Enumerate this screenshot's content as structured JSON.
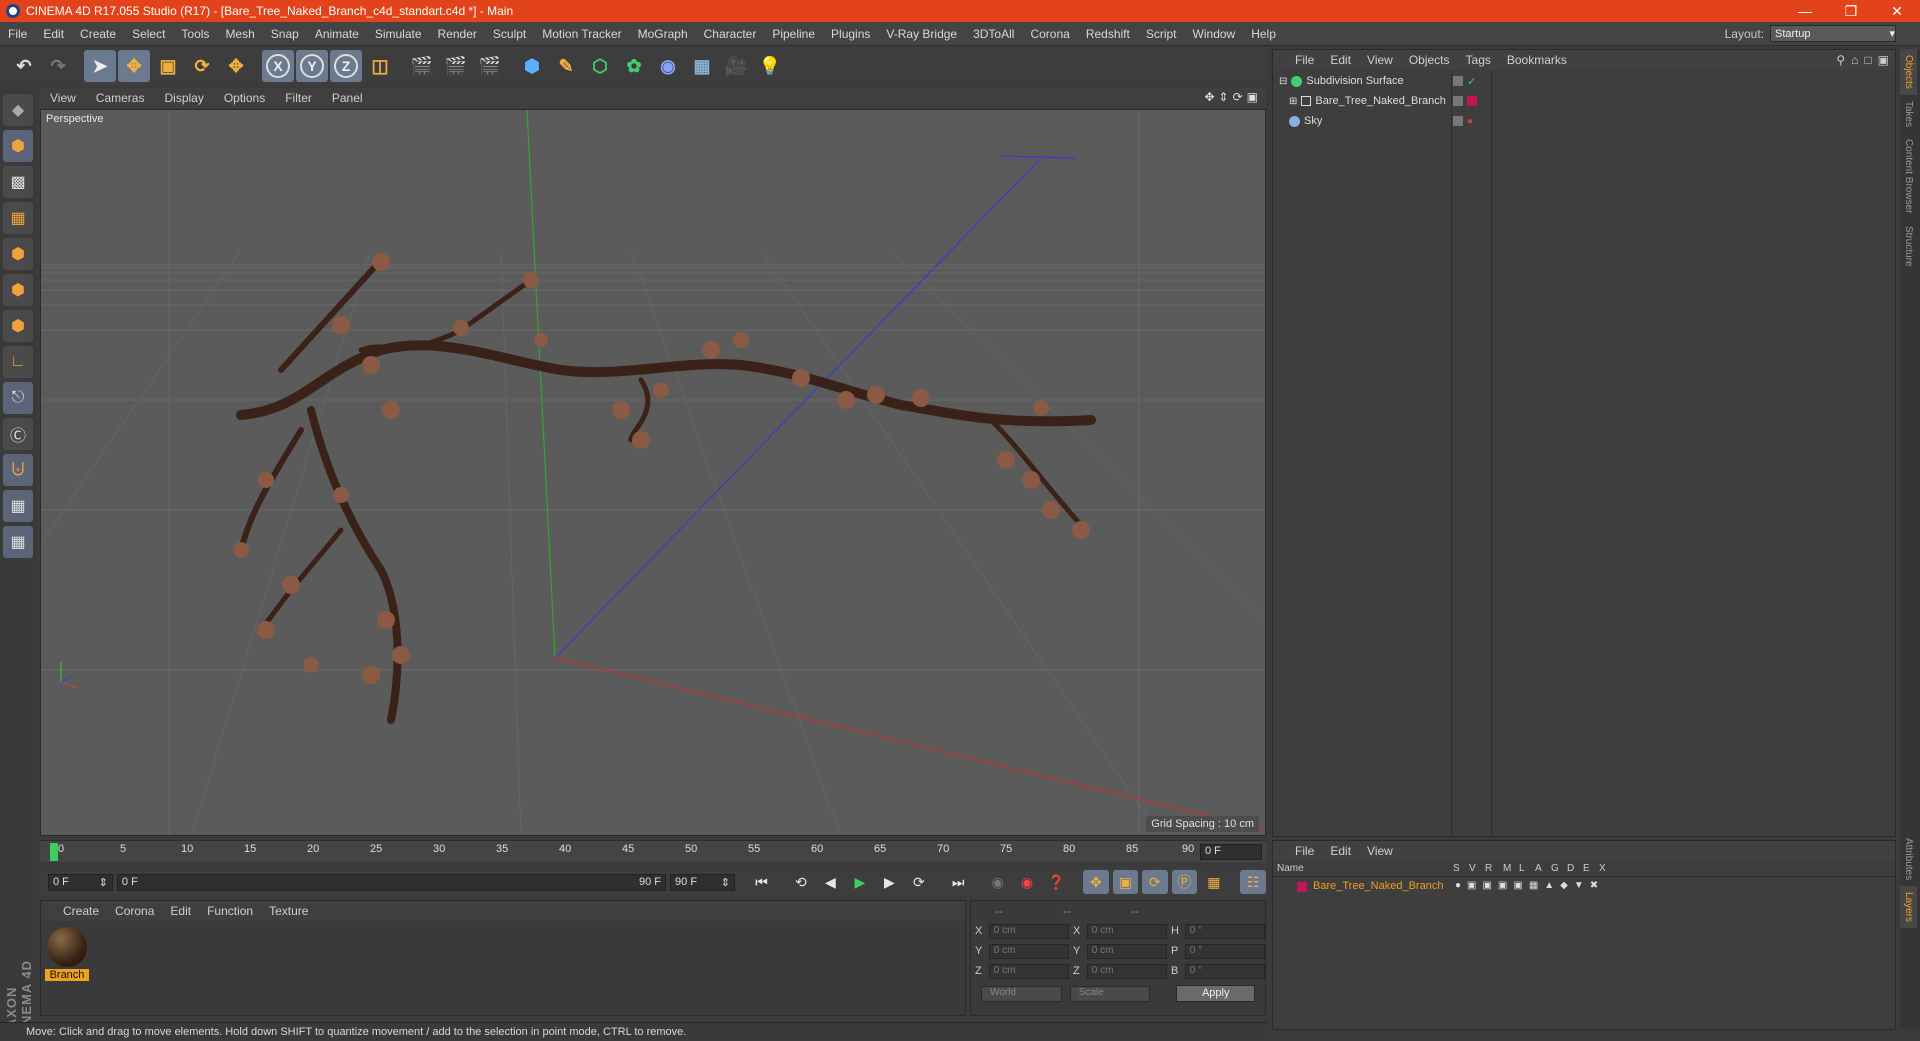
{
  "window": {
    "title": "CINEMA 4D R17.055 Studio (R17) - [Bare_Tree_Naked_Branch_c4d_standart.c4d *] - Main"
  },
  "menu": [
    "File",
    "Edit",
    "Create",
    "Select",
    "Tools",
    "Mesh",
    "Snap",
    "Animate",
    "Simulate",
    "Render",
    "Sculpt",
    "Motion Tracker",
    "MoGraph",
    "Character",
    "Pipeline",
    "Plugins",
    "V-Ray Bridge",
    "3DToAll",
    "Corona",
    "Redshift",
    "Script",
    "Window",
    "Help"
  ],
  "layout": {
    "label": "Layout:",
    "value": "Startup"
  },
  "viewport": {
    "menu": [
      "View",
      "Cameras",
      "Display",
      "Options",
      "Filter",
      "Panel"
    ],
    "label": "Perspective",
    "grid_spacing": "Grid Spacing : 10 cm"
  },
  "timeline": {
    "ticks": [
      "0",
      "5",
      "10",
      "15",
      "20",
      "25",
      "30",
      "35",
      "40",
      "45",
      "50",
      "55",
      "60",
      "65",
      "70",
      "75",
      "80",
      "85",
      "90"
    ],
    "current": "0 F",
    "start": "0 F",
    "range_start": "0 F",
    "range_end": "90 F",
    "end": "90 F"
  },
  "materials": {
    "menu": [
      "Create",
      "Corona",
      "Edit",
      "Function",
      "Texture"
    ],
    "items": [
      {
        "name": "Branch"
      }
    ]
  },
  "coords": {
    "head": [
      "--",
      "--",
      "--"
    ],
    "rows": [
      {
        "a": "X",
        "v1": "0 cm",
        "b": "X",
        "v2": "0 cm",
        "c": "H",
        "v3": "0 °"
      },
      {
        "a": "Y",
        "v1": "0 cm",
        "b": "Y",
        "v2": "0 cm",
        "c": "P",
        "v3": "0 °"
      },
      {
        "a": "Z",
        "v1": "0 cm",
        "b": "Z",
        "v2": "0 cm",
        "c": "B",
        "v3": "0 °"
      }
    ],
    "world": "World",
    "scale": "Scale",
    "apply": "Apply"
  },
  "objects": {
    "menu": [
      "File",
      "Edit",
      "View",
      "Objects",
      "Tags",
      "Bookmarks"
    ],
    "items": [
      {
        "name": "Subdivision Surface"
      },
      {
        "name": "Bare_Tree_Naked_Branch"
      },
      {
        "name": "Sky"
      }
    ]
  },
  "side_tabs": [
    "Objects",
    "Takes",
    "Content Browser",
    "Structure"
  ],
  "side_tabs_bottom": [
    "Attributes",
    "Layers"
  ],
  "layers": {
    "menu": [
      "File",
      "Edit",
      "View"
    ],
    "columns": [
      "Name",
      "S",
      "V",
      "R",
      "M",
      "L",
      "A",
      "G",
      "D",
      "E",
      "X"
    ],
    "items": [
      {
        "name": "Bare_Tree_Naked_Branch"
      }
    ]
  },
  "status": "Move: Click and drag to move elements. Hold down SHIFT to quantize movement / add to the selection in point mode, CTRL to remove.",
  "colors": {
    "accent": "#e2431a",
    "selected": "#f0a020",
    "layer_color": "#c0175a"
  }
}
